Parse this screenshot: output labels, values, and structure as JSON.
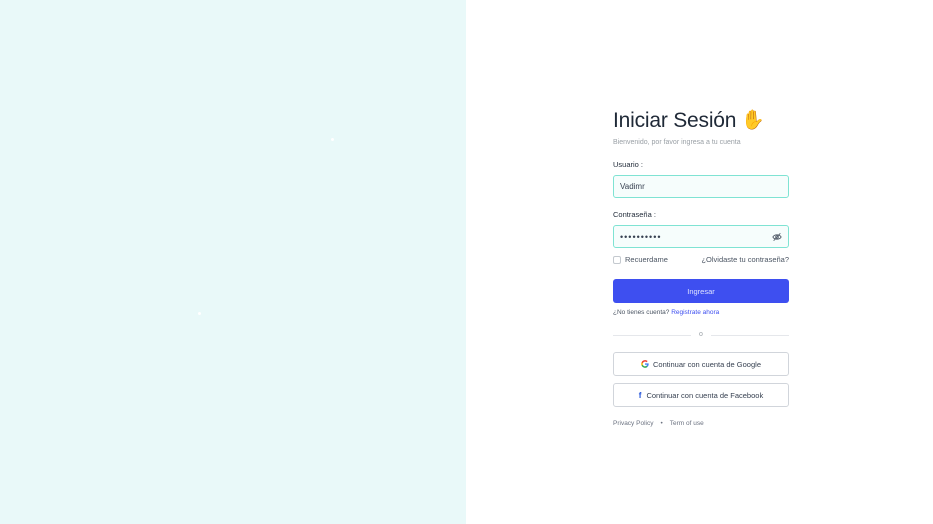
{
  "login": {
    "title": "Iniciar Sesión",
    "subtitle": "Bienvenido, por favor ingresa a tu cuenta",
    "username_label": "Usuario :",
    "username_value": "Vadimr",
    "password_label": "Contraseña :",
    "password_mask": "••••••••••",
    "remember_label": "Recuerdame",
    "forgot_link": "¿Olvidaste tu contraseña?",
    "submit_label": "Ingresar",
    "no_account_text": "¿No tienes cuenta?",
    "register_link": "Registrate ahora",
    "divider_text": "o",
    "google_button": "Continuar con cuenta de Google",
    "facebook_button": "Continuar con cuenta de Facebook",
    "privacy_link": "Privacy Policy",
    "separator": "•",
    "terms_link": "Term of use"
  },
  "icons": {
    "title_icon": "waving-hand-icon",
    "password_toggle": "eye-off-icon",
    "google": "google-icon",
    "facebook": "facebook-icon"
  },
  "colors": {
    "left_panel_bg": "#e9f9f9",
    "accent": "#3e4ff0",
    "field_border": "#7fe3d3"
  }
}
